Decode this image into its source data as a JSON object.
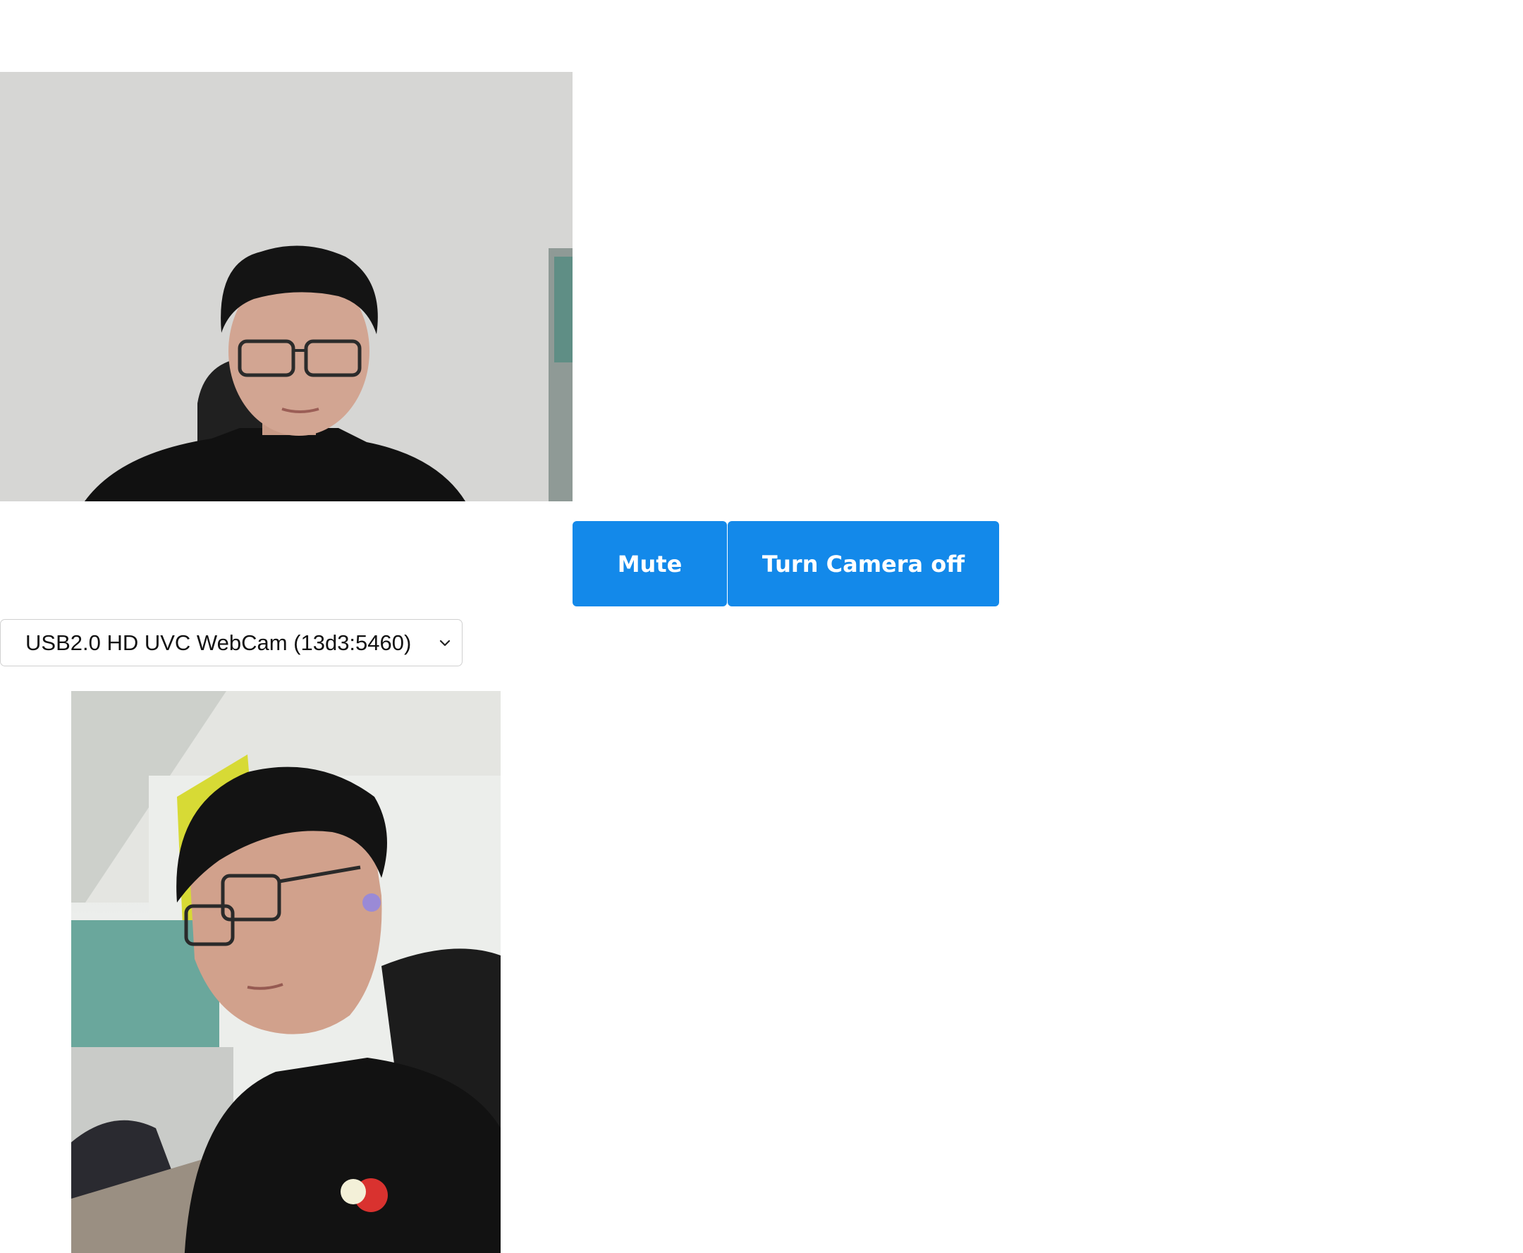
{
  "controls": {
    "mute_label": "Mute",
    "camera_label": "Turn Camera off"
  },
  "camera_select": {
    "selected": "USB2.0 HD UVC WebCam (13d3:5460)",
    "icon": "chevron-down-icon"
  },
  "videos": {
    "local": {
      "icon": "webcam-video-feed"
    },
    "remote": {
      "icon": "peer-video-feed"
    }
  },
  "colors": {
    "button_bg": "#1389ea",
    "button_text": "#ffffff",
    "page_bg": "#ffffff"
  }
}
